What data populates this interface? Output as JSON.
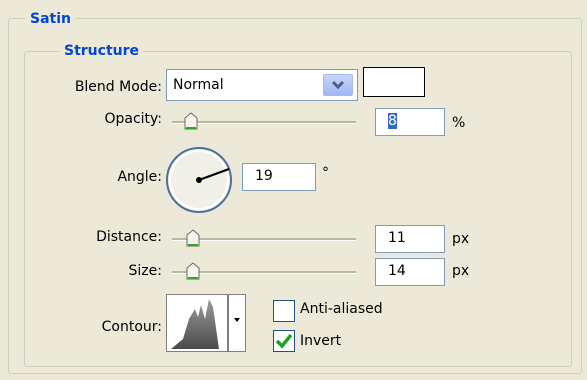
{
  "satin": {
    "title": "Satin",
    "structure": {
      "title": "Structure",
      "blend_mode": {
        "label": "Blend Mode:",
        "value": "Normal",
        "color": "#ffffff"
      },
      "opacity": {
        "label": "Opacity:",
        "value": "8",
        "unit": "%"
      },
      "angle": {
        "label": "Angle:",
        "value": "19",
        "unit": "°"
      },
      "distance": {
        "label": "Distance:",
        "value": "11",
        "unit": "px"
      },
      "size": {
        "label": "Size:",
        "value": "14",
        "unit": "px"
      },
      "contour": {
        "label": "Contour:",
        "anti_aliased": {
          "label": "Anti-aliased",
          "checked": false
        },
        "invert": {
          "label": "Invert",
          "checked": true
        }
      }
    }
  }
}
